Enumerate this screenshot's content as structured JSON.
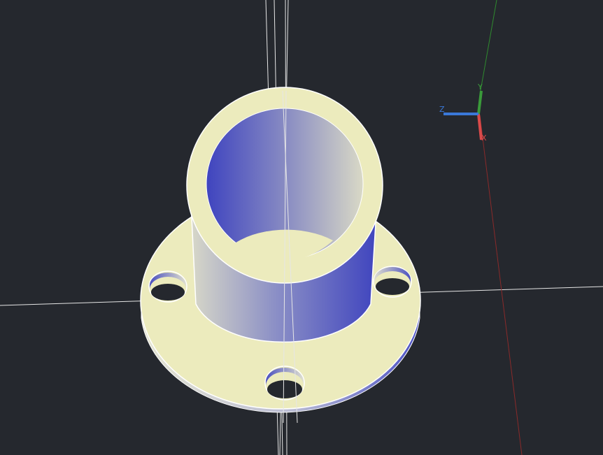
{
  "viewport": {
    "background": "#25282e",
    "construction_line_color": "#e6e6e6"
  },
  "model": {
    "face_color": "#ecebbd",
    "edge_color": "#ffffff",
    "shade_dark": "#4248c0",
    "shade_light": "#d5d5c8",
    "bolt_hole_count": 3
  },
  "axis_triad": {
    "x_label": "X",
    "y_label": "Y",
    "z_label": "Z",
    "x_color": "#d94a4a",
    "y_color": "#3a9a3a",
    "z_color": "#3a78d8"
  }
}
